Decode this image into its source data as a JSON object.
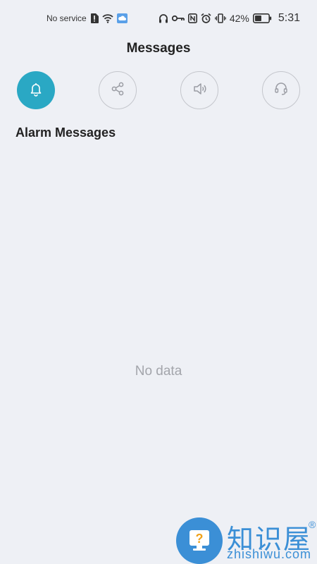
{
  "status_bar": {
    "carrier": "No service",
    "battery_percent": "42%",
    "time": "5:31",
    "icons": [
      "alert-sim-icon",
      "wifi-icon",
      "cloud-icon",
      "headphones-icon",
      "key-icon",
      "nfc-icon",
      "alarm-icon",
      "vibrate-icon",
      "battery-icon"
    ]
  },
  "header": {
    "title": "Messages"
  },
  "categories": [
    {
      "icon": "bell-icon",
      "active": true
    },
    {
      "icon": "share-icon",
      "active": false
    },
    {
      "icon": "speaker-icon",
      "active": false
    },
    {
      "icon": "headset-icon",
      "active": false
    }
  ],
  "section": {
    "title": "Alarm Messages",
    "empty_text": "No data"
  },
  "watermark": {
    "brand_cn": "知识屋",
    "brand_en": "zhishiwu.com",
    "registered": "®"
  },
  "colors": {
    "accent": "#2aa8c4",
    "background": "#eef0f5",
    "muted": "#a3a5ab",
    "watermark": "#3b8fd6"
  }
}
